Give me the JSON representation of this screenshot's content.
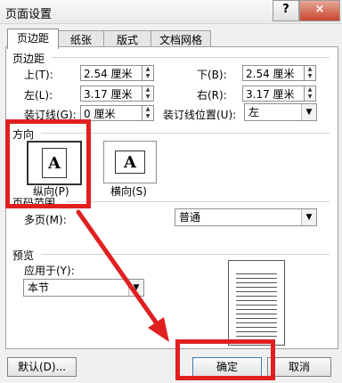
{
  "window": {
    "title": "页面设置",
    "help_glyph": "?",
    "close_glyph": "×"
  },
  "tabs": [
    {
      "label": "页边距",
      "active": true
    },
    {
      "label": "纸张",
      "active": false
    },
    {
      "label": "版式",
      "active": false
    },
    {
      "label": "文档网格",
      "active": false
    }
  ],
  "margins": {
    "group_label": "页边距",
    "top_label": "上(T):",
    "top_value": "2.54 厘米",
    "bottom_label": "下(B):",
    "bottom_value": "2.54 厘米",
    "left_label": "左(L):",
    "left_value": "3.17 厘米",
    "right_label": "右(R):",
    "right_value": "3.17 厘米",
    "gutter_label": "装订线(G):",
    "gutter_value": "0 厘米",
    "gutter_pos_label": "装订线位置(U):",
    "gutter_pos_value": "左"
  },
  "orientation": {
    "group_label": "方向",
    "portrait_label": "纵向(P)",
    "landscape_label": "横向(S)",
    "icon_letter": "A"
  },
  "pages": {
    "group_label": "页码范围",
    "multiple_label": "多页(M):",
    "multiple_value": "普通"
  },
  "preview": {
    "group_label": "预览",
    "apply_label": "应用于(Y):",
    "apply_value": "本节"
  },
  "buttons": {
    "default": "默认(D)...",
    "ok": "确定",
    "cancel": "取消"
  },
  "colors": {
    "annotation_red": "#e02020"
  }
}
